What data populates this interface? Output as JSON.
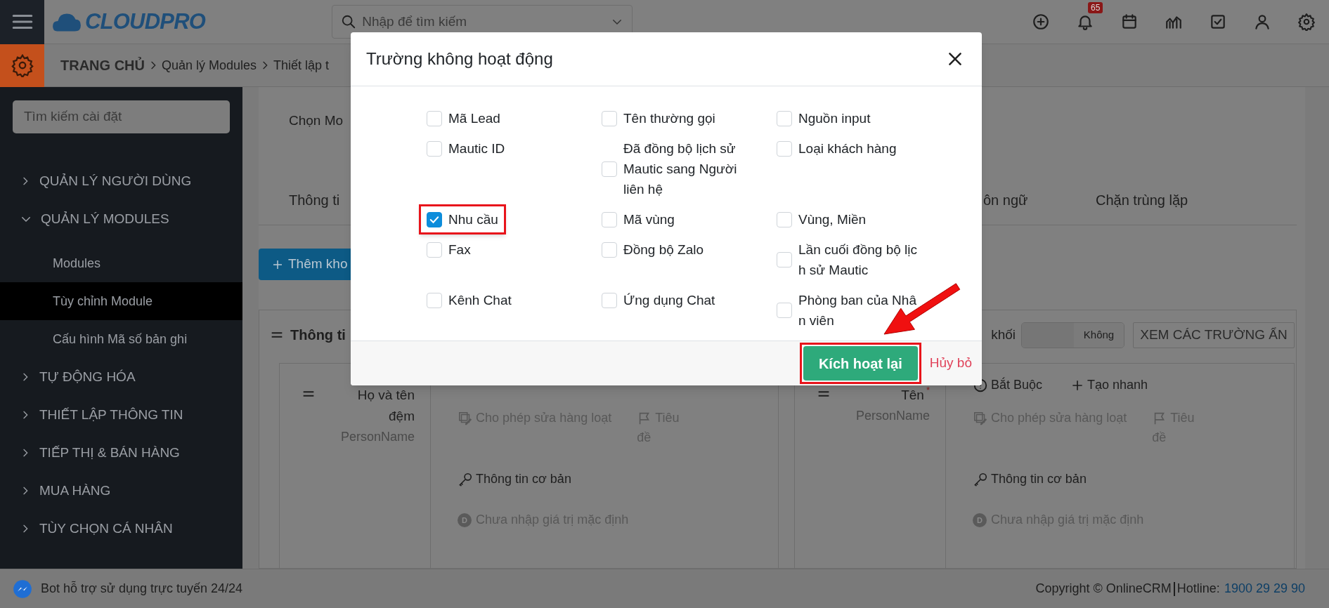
{
  "topbar": {
    "logo": "CLOUDPRO",
    "search_placeholder": "Nhập để tìm kiếm",
    "notification_count": "65"
  },
  "breadcrumb": [
    "TRANG CHỦ",
    "Quản lý Modules",
    "Thiết lập t"
  ],
  "sidebar": {
    "search_placeholder": "Tìm kiếm cài đặt",
    "items": [
      {
        "label": "QUẢN LÝ NGƯỜI DÙNG",
        "expanded": false
      },
      {
        "label": "QUẢN LÝ MODULES",
        "expanded": true,
        "children": [
          {
            "label": "Modules",
            "selected": false
          },
          {
            "label": "Tùy chỉnh Module",
            "selected": true
          },
          {
            "label": "Cấu hình Mã số bản ghi",
            "selected": false
          }
        ]
      },
      {
        "label": "TỰ ĐỘNG HÓA",
        "expanded": false
      },
      {
        "label": "THIẾT LẬP THÔNG TIN",
        "expanded": false
      },
      {
        "label": "TIẾP THỊ & BÁN HÀNG",
        "expanded": false
      },
      {
        "label": "MUA HÀNG",
        "expanded": false
      },
      {
        "label": "TÙY CHỌN CÁ NHÂN",
        "expanded": false
      }
    ]
  },
  "page": {
    "module_label": "Chọn Mo",
    "tabs": [
      "Thông ti",
      "ôn ngữ",
      "Chặn trùng lặp"
    ],
    "add_button": "Thêm kho",
    "section": {
      "title": "Thông ti",
      "bulk_label": "khối",
      "toggle": {
        "label": "Không",
        "on": false
      },
      "hidden_fields_button": "XEM CÁC TRƯỜNG ẨN"
    },
    "cards": [
      {
        "field_name": "Họ và tên đệm",
        "field_type": "PersonName",
        "required": false,
        "options": [
          {
            "kind": "mass_edit",
            "label": "Cho phép sửa hàng loạt",
            "active": false
          },
          {
            "kind": "title",
            "label": "Tiêu đề",
            "active": false
          },
          {
            "kind": "block",
            "label": "Thông tin cơ bản",
            "active": true
          },
          {
            "kind": "default",
            "badge": "D",
            "label": "Chưa nhập giá trị mặc định",
            "active": false
          }
        ]
      },
      {
        "field_name": "Tên",
        "field_type": "PersonName",
        "required": true,
        "required_mark": "*",
        "options": [
          {
            "kind": "required",
            "label": "Bắt Buộc",
            "active": true
          },
          {
            "kind": "quick_create",
            "label": "Tạo nhanh",
            "active": true
          },
          {
            "kind": "mass_edit",
            "label": "Cho phép sửa hàng loạt",
            "active": false
          },
          {
            "kind": "title",
            "label": "Tiêu đề",
            "active": false
          },
          {
            "kind": "block",
            "label": "Thông tin cơ bản",
            "active": true
          },
          {
            "kind": "default",
            "badge": "D",
            "label": "Chưa nhập giá trị mặc định",
            "active": false
          }
        ]
      }
    ]
  },
  "modal": {
    "title": "Trường không hoạt động",
    "fields": [
      {
        "label": "Mã Lead",
        "checked": false,
        "highlighted": false
      },
      {
        "label": "Tên thường gọi",
        "checked": false,
        "highlighted": false
      },
      {
        "label": "Nguồn input",
        "checked": false,
        "highlighted": false
      },
      {
        "label": "Mautic ID",
        "checked": false,
        "highlighted": false
      },
      {
        "label": "Đã đồng bộ lịch sử Mautic sang Người liên hệ",
        "checked": false,
        "highlighted": false
      },
      {
        "label": "Loại khách hàng",
        "checked": false,
        "highlighted": false
      },
      {
        "label": "Nhu cầu",
        "checked": true,
        "highlighted": true
      },
      {
        "label": "Mã vùng",
        "checked": false,
        "highlighted": false
      },
      {
        "label": "Vùng, Miền",
        "checked": false,
        "highlighted": false
      },
      {
        "label": "Fax",
        "checked": false,
        "highlighted": false
      },
      {
        "label": "Đồng bộ Zalo",
        "checked": false,
        "highlighted": false
      },
      {
        "label": "Lần cuối đồng bộ lịch sử Mautic",
        "checked": false,
        "highlighted": false
      },
      {
        "label": "Kênh Chat",
        "checked": false,
        "highlighted": false
      },
      {
        "label": "Ứng dụng Chat",
        "checked": false,
        "highlighted": false
      },
      {
        "label": "Phòng ban của Nhân viên",
        "checked": false,
        "highlighted": false
      }
    ],
    "buttons": [
      {
        "kind": "primary",
        "label": "Kích hoạt lại",
        "highlighted": true
      },
      {
        "kind": "link",
        "label": "Hủy bỏ",
        "highlighted": false
      }
    ],
    "pointer_arrow": true
  },
  "footer": {
    "chat_label": "Bot hỗ trợ sử dụng trực tuyến 24/24",
    "copyright": "Copyright © OnlineCRM",
    "hotline_label": "Hotline:",
    "hotline": "1900 29 29 90"
  }
}
